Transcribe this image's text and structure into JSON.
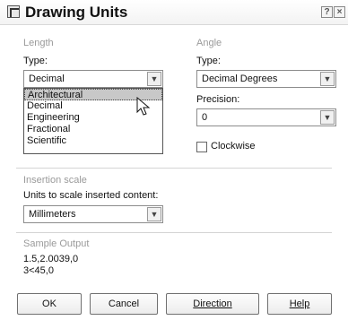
{
  "window": {
    "title": "Drawing Units",
    "help_glyph": "?",
    "close_glyph": "×"
  },
  "length": {
    "group_label": "Length",
    "type_label": "Type:",
    "type_value": "Decimal",
    "type_options": [
      "Architectural",
      "Decimal",
      "Engineering",
      "Fractional",
      "Scientific"
    ],
    "highlighted_option": "Architectural"
  },
  "angle": {
    "group_label": "Angle",
    "type_label": "Type:",
    "type_value": "Decimal Degrees",
    "precision_label": "Precision:",
    "precision_value": "0",
    "clockwise_label": "Clockwise",
    "clockwise_checked": false
  },
  "insertion": {
    "group_label": "Insertion scale",
    "units_label": "Units to scale inserted content:",
    "units_value": "Millimeters"
  },
  "sample": {
    "group_label": "Sample Output",
    "line1": "1.5,2.0039,0",
    "line2": "3<45,0"
  },
  "buttons": {
    "ok": "OK",
    "cancel": "Cancel",
    "direction": "Direction",
    "help": "Help"
  },
  "icons": {
    "dropdown": "chevron-down-icon",
    "cursor": "mouse-pointer-icon",
    "app": "drawing-units-icon"
  }
}
